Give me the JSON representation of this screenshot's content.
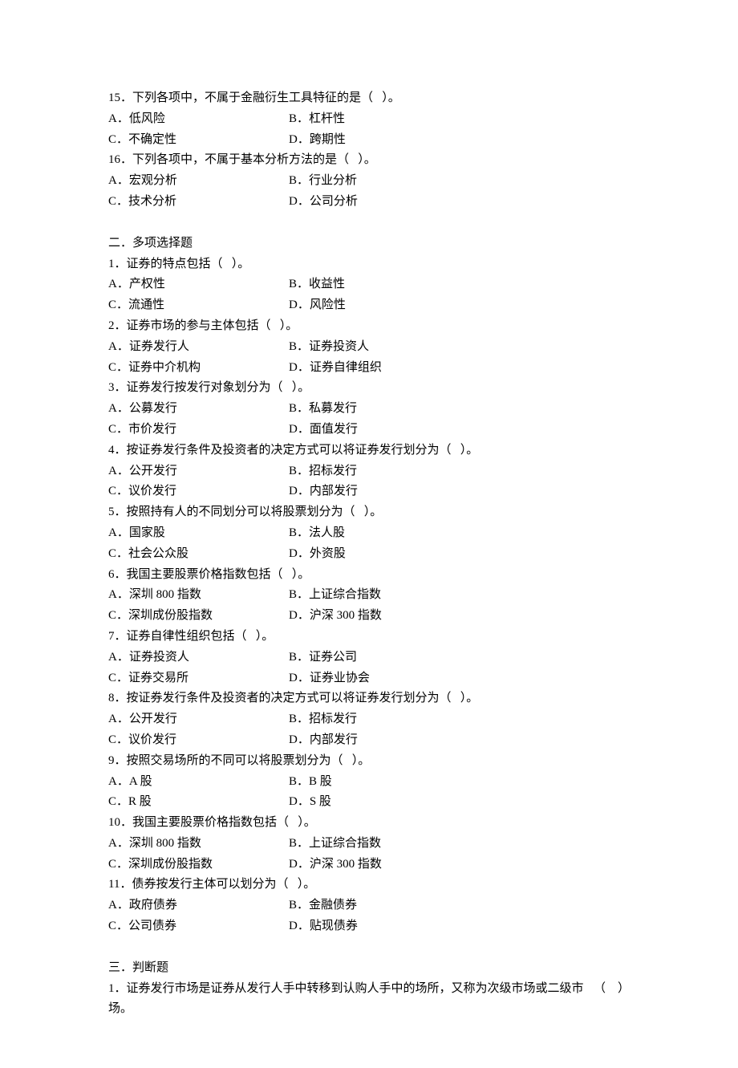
{
  "single": {
    "q15": {
      "stem": "15．下列各项中，不属于金融衍生工具特征的是（   ）。",
      "a": "A．低风险",
      "b": "B．杠杆性",
      "c": "C．不确定性",
      "d": "D．跨期性"
    },
    "q16": {
      "stem": "16．下列各项中，不属于基本分析方法的是（   ）。",
      "a": "A．宏观分析",
      "b": "B．行业分析",
      "c": "C．技术分析",
      "d": "D．公司分析"
    }
  },
  "multi": {
    "heading": "二．多项选择题",
    "q1": {
      "stem": "1．证券的特点包括（   ）。",
      "a": "A．产权性",
      "b": "B．收益性",
      "c": "C．流通性",
      "d": "D．风险性"
    },
    "q2": {
      "stem": "2．证券市场的参与主体包括（   ）。",
      "a": "A．证券发行人",
      "b": "B．证券投资人",
      "c": "C．证券中介机构",
      "d": "D．证券自律组织"
    },
    "q3": {
      "stem": "3．证券发行按发行对象划分为（   ）。",
      "a": "A．公募发行",
      "b": "B．私募发行",
      "c": "C．市价发行",
      "d": "D．面值发行"
    },
    "q4": {
      "stem": "4．按证券发行条件及投资者的决定方式可以将证券发行划分为（   ）。",
      "a": "A．公开发行",
      "b": "B．招标发行",
      "c": "C．议价发行",
      "d": "D．内部发行"
    },
    "q5": {
      "stem": "5．按照持有人的不同划分可以将股票划分为（   ）。",
      "a": "A．国家股",
      "b": "B．法人股",
      "c": "C．社会公众股",
      "d": "D．外资股"
    },
    "q6": {
      "stem": "6．我国主要股票价格指数包括（   ）。",
      "a": "A．深圳 800 指数",
      "b": "B．上证综合指数",
      "c": "C．深圳成份股指数",
      "d": "D．沪深 300 指数"
    },
    "q7": {
      "stem": "7．证券自律性组织包括（   ）。",
      "a": "A．证券投资人",
      "b": "B．证券公司",
      "c": "C．证券交易所",
      "d": "D．证券业协会"
    },
    "q8": {
      "stem": "8．按证券发行条件及投资者的决定方式可以将证券发行划分为（   ）。",
      "a": "A．公开发行",
      "b": "B．招标发行",
      "c": "C．议价发行",
      "d": "D．内部发行"
    },
    "q9": {
      "stem": "9．按照交易场所的不同可以将股票划分为（   ）。",
      "a": "A．A 股",
      "b": "B．B 股",
      "c": "C．R 股",
      "d": "D．S 股"
    },
    "q10": {
      "stem": "10．我国主要股票价格指数包括（   ）。",
      "a": "A．深圳 800 指数",
      "b": "B．上证综合指数",
      "c": "C．深圳成份股指数",
      "d": "D．沪深 300 指数"
    },
    "q11": {
      "stem": "11．债券按发行主体可以划分为（   ）。",
      "a": "A．政府债券",
      "b": "B．金融债券",
      "c": "C．公司债券",
      "d": "D．贴现债券"
    }
  },
  "tf": {
    "heading": "三．判断题",
    "q1": {
      "stem": "1．证券发行市场是证券从发行人手中转移到认购人手中的场所，又称为次级市场或二级市场。",
      "blank": "（    ）"
    }
  }
}
